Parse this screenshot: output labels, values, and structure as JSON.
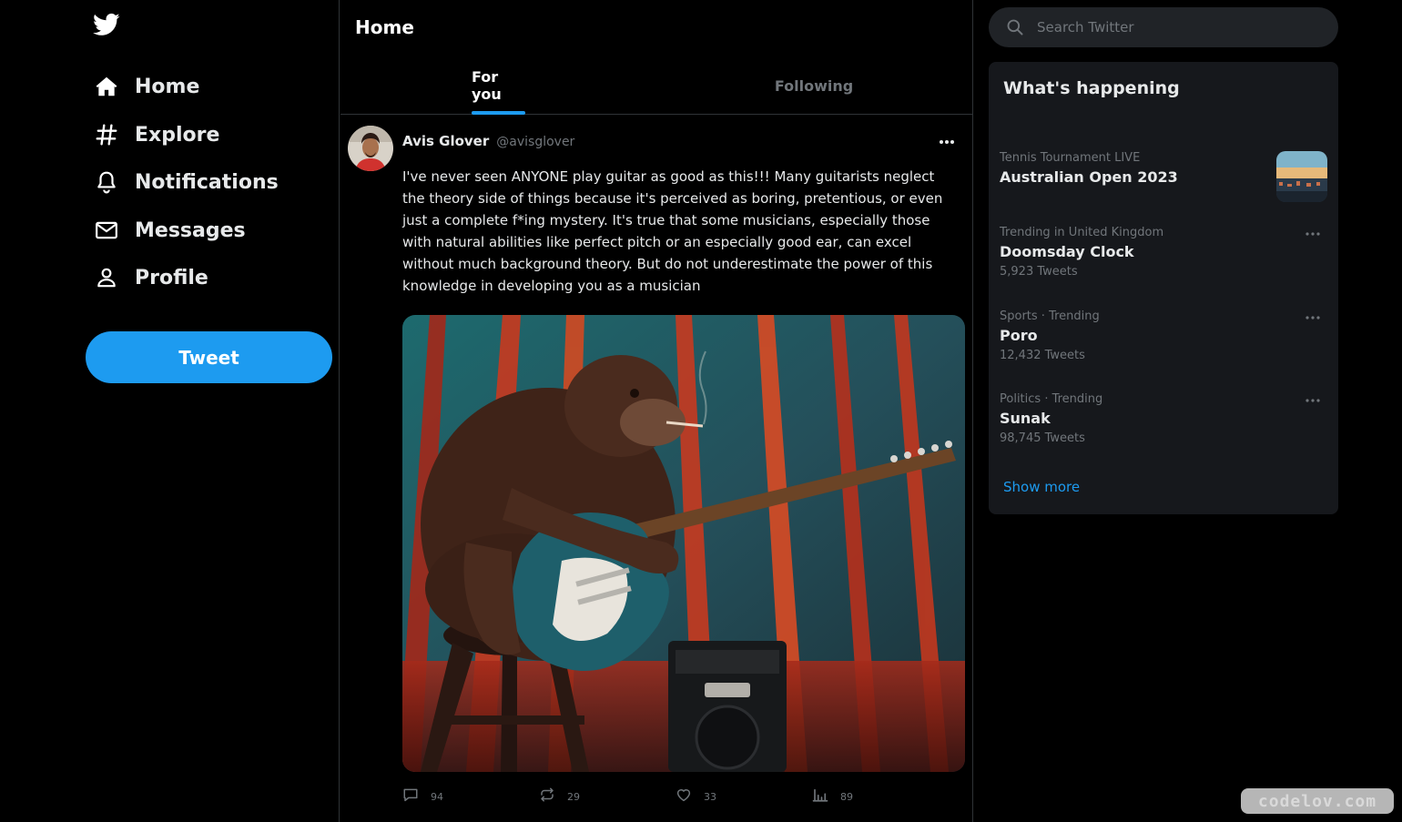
{
  "nav": {
    "items": [
      {
        "label": "Home",
        "icon": "home-icon"
      },
      {
        "label": "Explore",
        "icon": "hashtag-icon"
      },
      {
        "label": "Notifications",
        "icon": "bell-icon"
      },
      {
        "label": "Messages",
        "icon": "envelope-icon"
      },
      {
        "label": "Profile",
        "icon": "person-icon"
      }
    ],
    "tweet_button": "Tweet",
    "logo": "twitter-bird-icon"
  },
  "main": {
    "title": "Home",
    "tabs": [
      {
        "label": "For you",
        "active": true
      },
      {
        "label": "Following",
        "active": false
      }
    ]
  },
  "tweet": {
    "name": "Avis Glover",
    "handle": "@avisglover",
    "text": "I've never seen ANYONE play guitar as good as this!!! Many guitarists neglect the theory side of things because it's perceived as boring, pretentious, or even just a complete f*ing mystery. It's true that some musicians, especially those with natural abilities like perfect pitch or an especially good ear, can excel without much background theory. But do not underestimate the power of this knowledge in developing you as a musician",
    "actions": {
      "replies": "94",
      "retweets": "29",
      "likes": "33",
      "views": "89"
    }
  },
  "search": {
    "placeholder": "Search Twitter"
  },
  "trends": {
    "title": "What's happening",
    "items": [
      {
        "context": "Tennis Tournament LIVE",
        "name": "Australian Open 2023",
        "count": ""
      },
      {
        "context": "Trending in United Kingdom",
        "name": "Doomsday Clock",
        "count": "5,923 Tweets"
      },
      {
        "context": "Sports · Trending",
        "name": "Poro",
        "count": "12,432 Tweets"
      },
      {
        "context": "Politics · Trending",
        "name": "Sunak",
        "count": "98,745 Tweets"
      }
    ],
    "show_more": "Show more"
  },
  "watermark": "codelov.com",
  "colors": {
    "accent": "#1d9bf0",
    "background": "#000000",
    "card": "#16181c",
    "muted_text": "#71767b"
  }
}
